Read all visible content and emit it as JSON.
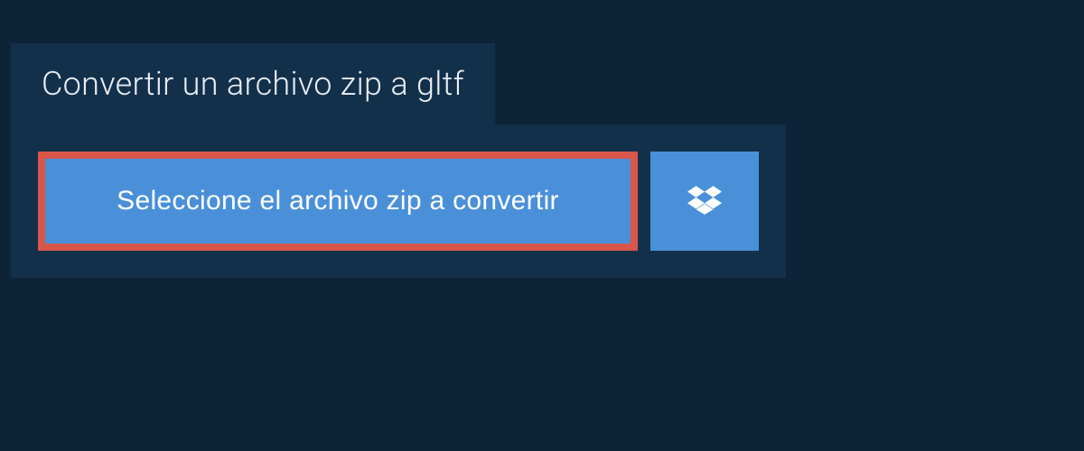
{
  "header": {
    "title": "Convertir un archivo zip a gltf"
  },
  "actions": {
    "select_file_label": "Seleccione el archivo zip a convertir",
    "dropbox_icon": "dropbox-icon"
  },
  "colors": {
    "page_bg": "#0d2438",
    "panel_bg": "#13304b",
    "button_bg": "#4a90d9",
    "highlight_border": "#d9564a",
    "text_light": "#ffffff"
  }
}
